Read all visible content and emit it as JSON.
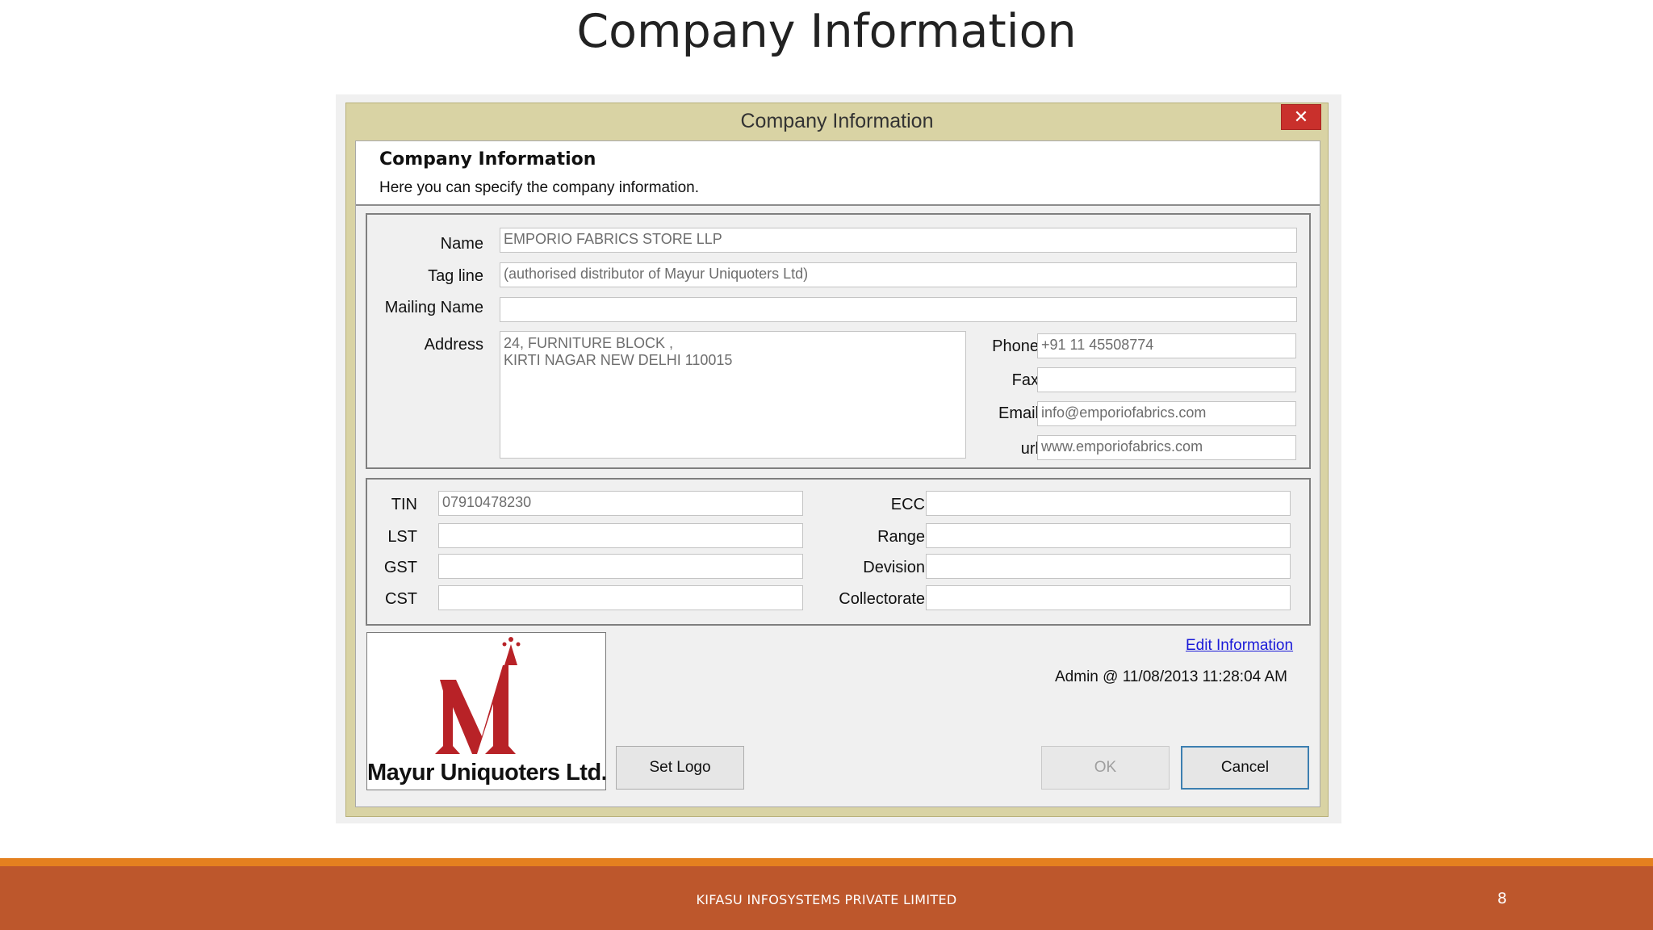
{
  "slide": {
    "title": "Company Information",
    "footer_text": "KIFASU INFOSYSTEMS PRIVATE LIMITED",
    "page_number": "8"
  },
  "window": {
    "title": "Company Information",
    "close_symbol": "✕"
  },
  "header": {
    "title": "Company Information",
    "subtitle": "Here you can specify the company information."
  },
  "form": {
    "name_label": "Name",
    "name_value": "EMPORIO FABRICS STORE LLP",
    "tagline_label": "Tag line",
    "tagline_value": "(authorised distributor of Mayur Uniquoters Ltd)",
    "mailing_label": "Mailing Name",
    "mailing_value": "",
    "address_label": "Address",
    "address_value": "24, FURNITURE BLOCK ,\nKIRTI NAGAR NEW DELHI 110015",
    "phone_label": "Phone",
    "phone_value": "+91 11 45508774",
    "fax_label": "Fax",
    "fax_value": "",
    "email_label": "Email",
    "email_value": "info@emporiofabrics.com",
    "url_label": "url",
    "url_value": "www.emporiofabrics.com"
  },
  "tax": {
    "tin_label": "TIN",
    "tin_value": "07910478230",
    "lst_label": "LST",
    "lst_value": "",
    "gst_label": "GST",
    "gst_value": "",
    "cst_label": "CST",
    "cst_value": "",
    "ecc_label": "ECC",
    "ecc_value": "",
    "range_label": "Range",
    "range_value": "",
    "division_label": "Devision",
    "division_value": "",
    "collectorate_label": "Collectorate",
    "collectorate_value": ""
  },
  "logo": {
    "company_name": "Mayur Uniquoters Ltd.",
    "colors": {
      "primary": "#b82227"
    }
  },
  "actions": {
    "set_logo": "Set Logo",
    "edit_info": "Edit Information",
    "audit": "Admin @ 11/08/2013 11:28:04 AM",
    "ok": "OK",
    "cancel": "Cancel"
  }
}
